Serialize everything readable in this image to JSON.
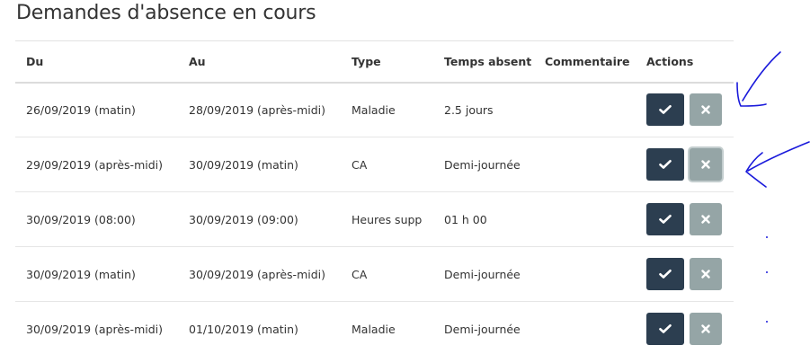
{
  "page": {
    "title": "Demandes d'absence en cours"
  },
  "table": {
    "headers": {
      "du": "Du",
      "au": "Au",
      "type": "Type",
      "temps": "Temps absent",
      "commentaire": "Commentaire",
      "actions": "Actions"
    },
    "rows": [
      {
        "du": "26/09/2019 (matin)",
        "au": "28/09/2019 (après-midi)",
        "type": "Maladie",
        "temps": "2.5 jours",
        "commentaire": ""
      },
      {
        "du": "29/09/2019 (après-midi)",
        "au": "30/09/2019 (matin)",
        "type": "CA",
        "temps": "Demi-journée",
        "commentaire": ""
      },
      {
        "du": "30/09/2019 (08:00)",
        "au": "30/09/2019 (09:00)",
        "type": "Heures supp",
        "temps": "01 h 00",
        "commentaire": ""
      },
      {
        "du": "30/09/2019 (matin)",
        "au": "30/09/2019 (après-midi)",
        "type": "CA",
        "temps": "Demi-journée",
        "commentaire": ""
      },
      {
        "du": "30/09/2019 (après-midi)",
        "au": "01/10/2019 (matin)",
        "type": "Maladie",
        "temps": "Demi-journée",
        "commentaire": ""
      }
    ]
  },
  "icons": {
    "approve": "check-icon",
    "reject": "close-icon"
  },
  "colors": {
    "approve_button": "#2c3e50",
    "reject_button": "#95a5a6",
    "annotation_ink": "#1a1adb"
  }
}
